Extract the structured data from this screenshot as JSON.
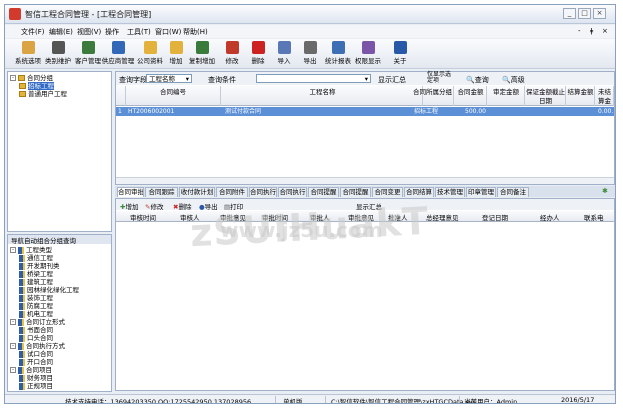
{
  "window": {
    "title": "智信工程合同管理 - [工程合同管理]"
  },
  "win_controls": {
    "min": "_",
    "max": "□",
    "close": "×"
  },
  "mdi_controls": {
    "min": "-",
    "restore": "ǂ",
    "close": "×"
  },
  "menu": [
    "文件(F)",
    "编辑(E)",
    "视图(V)",
    "操作",
    "工具(T)",
    "窗口(W)",
    "帮助(H)"
  ],
  "toolbar": [
    {
      "label": "系统选项",
      "color": "#d9a441"
    },
    {
      "label": "类别维护",
      "color": "#555555"
    },
    {
      "label": "客户管理",
      "color": "#3d7a3d"
    },
    {
      "label": "供应商管理",
      "color": "#3367b8"
    },
    {
      "label": "公司资料",
      "color": "#e3b23c"
    },
    {
      "label": "增加",
      "color": "#e3b23c"
    },
    {
      "label": "复制增加",
      "color": "#3a7a3a"
    },
    {
      "label": "修改",
      "color": "#c0392b"
    },
    {
      "label": "删除",
      "color": "#cc2222"
    },
    {
      "label": "导入",
      "color": "#5a78b6"
    },
    {
      "label": "导出",
      "color": "#6a6a6a"
    },
    {
      "label": "统计报表",
      "color": "#3c6fb4"
    },
    {
      "label": "权限显示",
      "color": "#7b56a8"
    },
    {
      "label": "关于",
      "color": "#2a58a8"
    }
  ],
  "tree1": {
    "header": "",
    "nodes": [
      {
        "label": "合同分组",
        "level": 0,
        "type": "folder",
        "toggle": "-"
      },
      {
        "label": "招标工程",
        "level": 1,
        "type": "item",
        "selected": true
      },
      {
        "label": "普通用户工程",
        "level": 1,
        "type": "item",
        "selected": false
      }
    ]
  },
  "tree2": {
    "header": "导航自动组合分组查询",
    "nodes": [
      {
        "label": "工程类型",
        "level": 0,
        "toggle": "-"
      },
      {
        "label": "通信工程",
        "level": 1
      },
      {
        "label": "开发期刊类",
        "level": 1
      },
      {
        "label": "桥梁工程",
        "level": 1
      },
      {
        "label": "建筑工程",
        "level": 1
      },
      {
        "label": "园林绿化绿化工程",
        "level": 1
      },
      {
        "label": "装饰工程",
        "level": 1
      },
      {
        "label": "防腐工程",
        "level": 1
      },
      {
        "label": "机电工程",
        "level": 1
      },
      {
        "label": "合同订立形式",
        "level": 0,
        "toggle": "-"
      },
      {
        "label": "书面合同",
        "level": 1
      },
      {
        "label": "口头合同",
        "level": 1
      },
      {
        "label": "合同执行方式",
        "level": 0,
        "toggle": "-"
      },
      {
        "label": "试口合同",
        "level": 1
      },
      {
        "label": "开口合同",
        "level": 1
      },
      {
        "label": "合同项目",
        "level": 0,
        "toggle": "-"
      },
      {
        "label": "财务项目",
        "level": 1
      },
      {
        "label": "正规项目",
        "level": 1
      }
    ]
  },
  "query": {
    "field_label": "查询字段",
    "field_value": "工程名称",
    "cond_label": "查询条件",
    "cond_value": "",
    "show_summary": "显示汇总",
    "query_btn": "查询",
    "advanced_btn": "高级",
    "show_options": "仅显示选\n定项"
  },
  "grid": {
    "columns": [
      "合同编号",
      "工程名称",
      "合同所属分组",
      "合同金额",
      "审定金额",
      "保证金额截止日期",
      "结算金额",
      "未结算金额"
    ],
    "rows": [
      {
        "idx": "1",
        "no": "HT2006002001",
        "name": "测试付款合同",
        "group": "招标工程",
        "amount": "500.00",
        "approved": "",
        "deposit_date": "",
        "settled": "",
        "unsettled": "0.00.900"
      }
    ]
  },
  "tabs": [
    "合同审批",
    "合同跟踪",
    "收付款计划",
    "合同附件",
    "合同执行",
    "合同执行",
    "合同提醒",
    "合同提醒",
    "合同变更",
    "合同结算",
    "技术管理",
    "印章管理",
    "合同备注"
  ],
  "subtoolbar": {
    "add": "增加",
    "edit": "修改",
    "del": "删除",
    "export": "导出",
    "print": "打印",
    "summary": "显示汇总"
  },
  "subgrid_columns": [
    "审核时间",
    "审核人",
    "审批意见",
    "审批时间",
    "审批人",
    "审批意见",
    "批准人",
    "总经理意见",
    "登记日期",
    "经办人",
    "联系电"
  ],
  "status": {
    "support": "技术支持电话：13694203350 QQ:1725542950 137028956",
    "mode": "单机版",
    "path": "C:\\智信软件\\智信工程合同管理\\zxHTGCData.sys",
    "user": "当前用户：Admin",
    "date": "2016/5/17"
  },
  "watermark": {
    "main": "zSUIHuakT",
    "sub": "www.jz5u.com"
  }
}
